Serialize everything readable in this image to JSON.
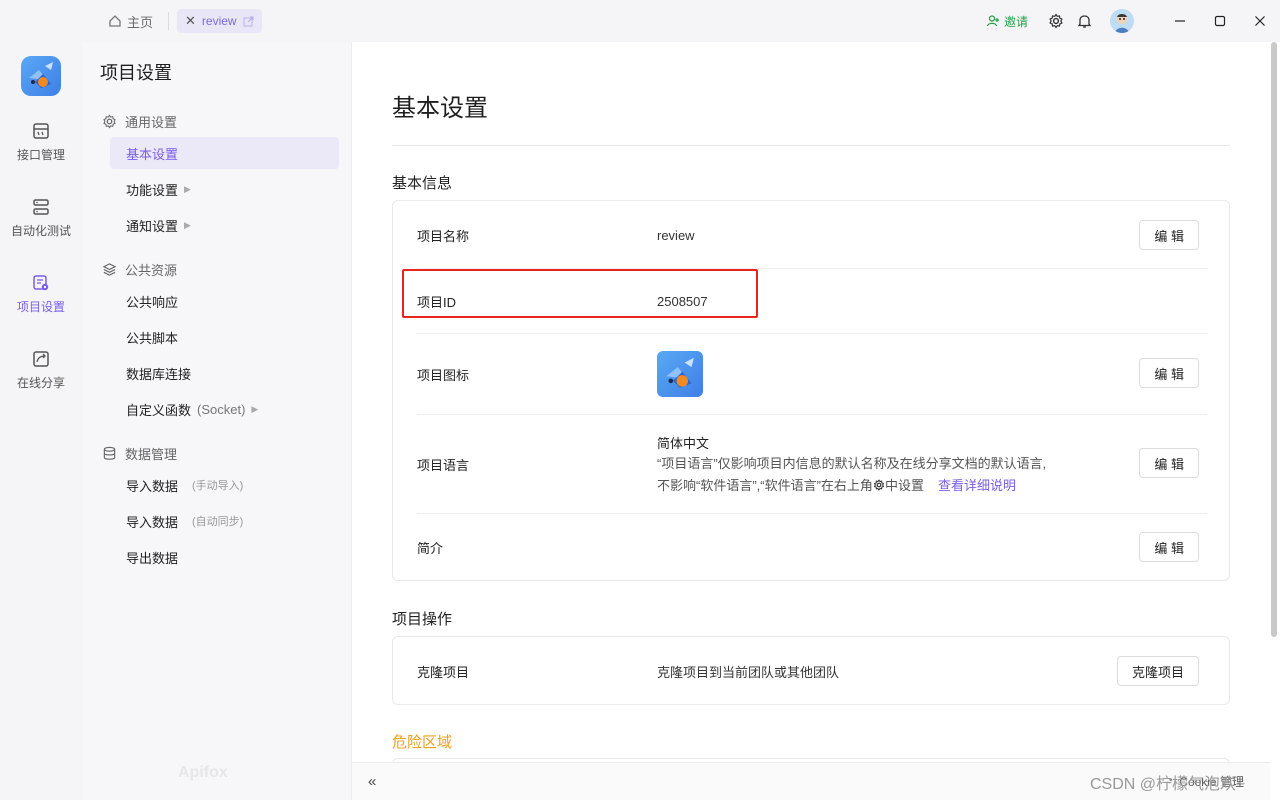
{
  "titlebar": {
    "home_tab": "主页",
    "active_tab": "review",
    "invite": "邀请"
  },
  "rail": {
    "items": [
      {
        "label": "接口管理",
        "icon": "api-icon"
      },
      {
        "label": "自动化测试",
        "icon": "automation-icon"
      },
      {
        "label": "项目设置",
        "icon": "project-settings-icon",
        "active": true
      },
      {
        "label": "在线分享",
        "icon": "share-icon"
      }
    ]
  },
  "snav": {
    "title": "项目设置",
    "general": {
      "label": "通用设置",
      "items": [
        "基本设置",
        "功能设置",
        "通知设置"
      ]
    },
    "resources": {
      "label": "公共资源",
      "items": [
        "公共响应",
        "公共脚本",
        "数据库连接",
        "自定义函数",
        "(Socket)"
      ]
    },
    "data": {
      "label": "数据管理",
      "items": [
        {
          "label": "导入数据",
          "sub": "(手动导入)"
        },
        {
          "label": "导入数据",
          "sub": "(自动同步)"
        },
        {
          "label": "导出数据",
          "sub": ""
        }
      ]
    },
    "brand": "Apifox"
  },
  "main": {
    "title": "基本设置",
    "basic": {
      "heading": "基本信息",
      "name_label": "项目名称",
      "name_value": "review",
      "id_label": "项目ID",
      "id_value": "2508507",
      "icon_label": "项目图标",
      "lang_label": "项目语言",
      "lang_value": "简体中文",
      "lang_note_1": "“项目语言”仅影响项目内信息的默认名称及在线分享文档的默认语言,",
      "lang_note_2a": "不影响“软件语言”,“软件语言”在右上角",
      "lang_note_2b": "中设置",
      "lang_link": "查看详细说明",
      "desc_label": "简介",
      "edit": "编 辑"
    },
    "ops": {
      "heading": "项目操作",
      "clone_label": "克隆项目",
      "clone_desc": "克隆项目到当前团队或其他团队",
      "clone_btn": "克隆项目"
    },
    "danger": {
      "heading": "危险区域"
    }
  },
  "bottombar": {
    "right_text": "Cookie 管理"
  },
  "watermark": "CSDN @柠檬气泡欢~",
  "colors": {
    "accent": "#7a5de8",
    "danger": "#f0a020",
    "highlight": "#e8251f",
    "invite": "#22a447"
  }
}
